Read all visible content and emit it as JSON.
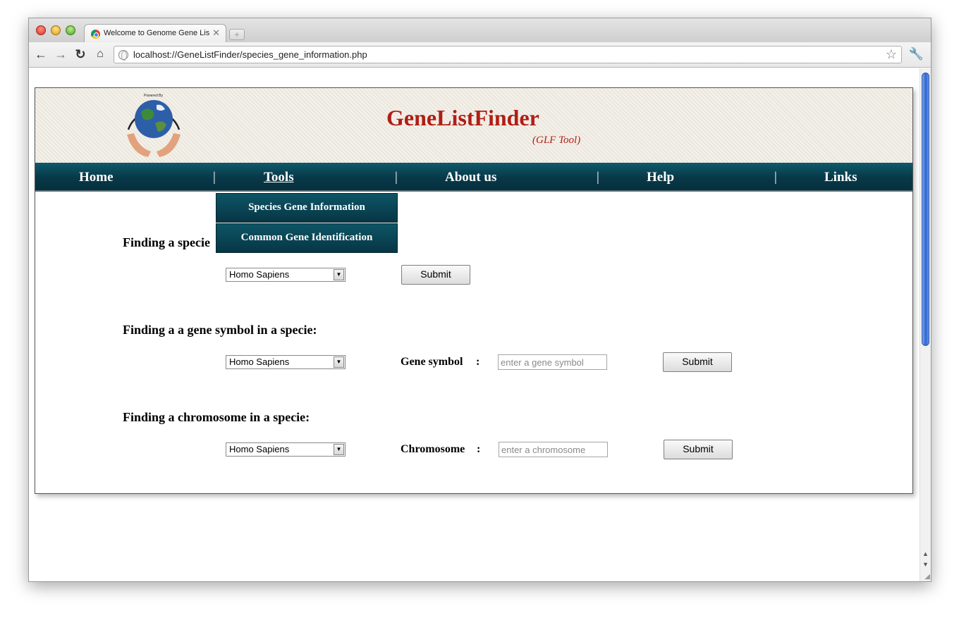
{
  "browser": {
    "tab_title": "Welcome to Genome Gene List Fi",
    "new_tab_label": "+",
    "url": "localhost://GeneListFinder/species_gene_information.php"
  },
  "site": {
    "title": "GeneListFinder",
    "subtitle": "(GLF Tool)",
    "logo_text": "Powered By"
  },
  "nav": {
    "home": "Home",
    "tools": "Tools",
    "about": "About us",
    "help": "Help",
    "links": "Links",
    "separator": "|"
  },
  "dropdown": {
    "items": [
      "Species Gene Information",
      "Common Gene Identification"
    ]
  },
  "sections": {
    "species": {
      "heading": "Finding a specie",
      "selected": "Homo Sapiens",
      "submit": "Submit"
    },
    "gene": {
      "heading": "Finding a a gene symbol in a specie:",
      "selected": "Homo Sapiens",
      "label": "Gene symbol",
      "colon": ":",
      "placeholder": "enter a gene symbol",
      "submit": "Submit"
    },
    "chromosome": {
      "heading": "Finding a chromosome in a specie:",
      "selected": "Homo Sapiens",
      "label": "Chromosome",
      "colon": ":",
      "placeholder": "enter a chromosome",
      "submit": "Submit"
    }
  },
  "colors": {
    "title_red": "#b01e16",
    "nav_teal": "#083848",
    "header_bg": "#efebe1"
  }
}
